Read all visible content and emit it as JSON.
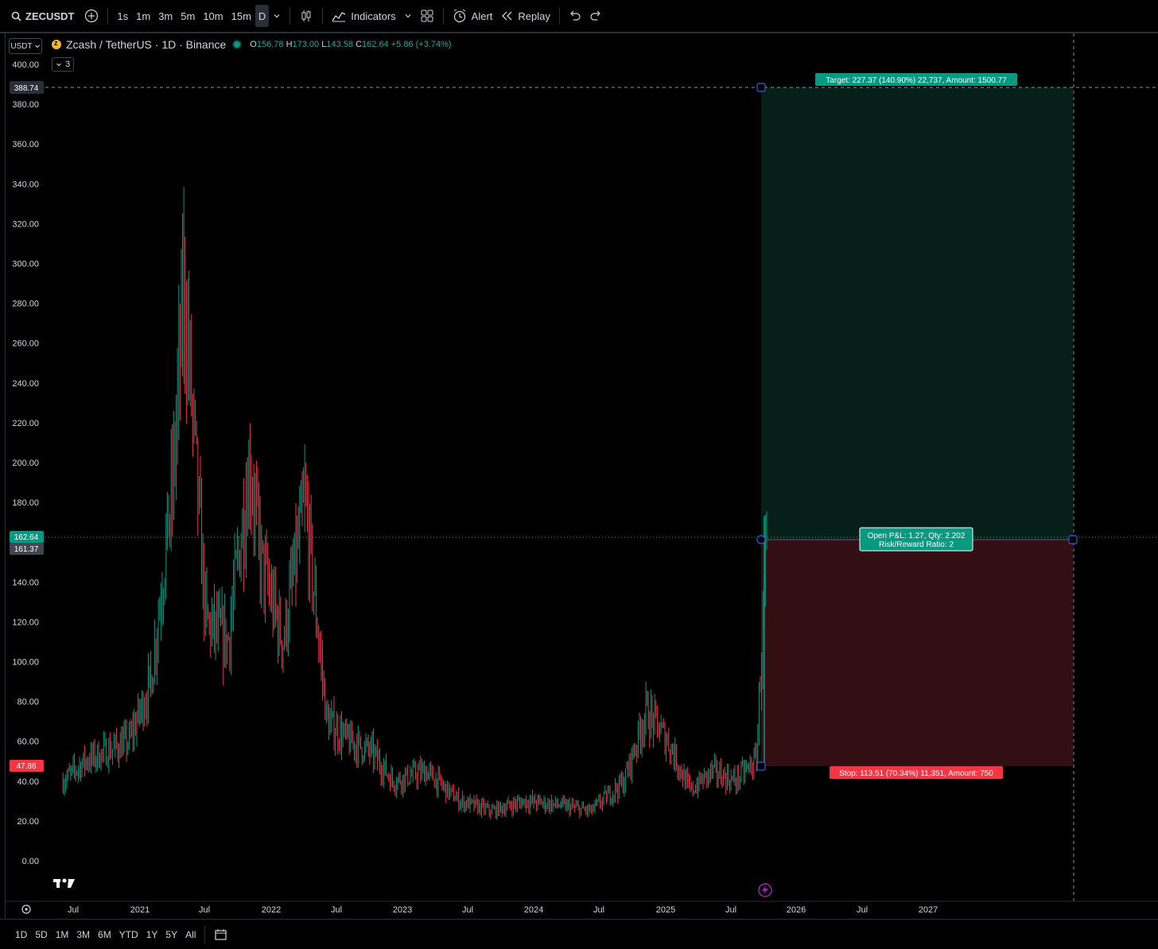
{
  "toolbar": {
    "symbol": "ZECUSDT",
    "intervals": [
      "1s",
      "1m",
      "3m",
      "5m",
      "10m",
      "15m"
    ],
    "active_interval": "D",
    "indicators_label": "Indicators",
    "alert_label": "Alert",
    "replay_label": "Replay"
  },
  "legend": {
    "currency": "USDT",
    "title": "Zcash / TetherUS · 1D · Binance",
    "o_label": "O",
    "o_value": "156.78",
    "h_label": "H",
    "h_value": "173.00",
    "l_label": "L",
    "l_value": "143.58",
    "c_label": "C",
    "c_value": "162.64",
    "change": "+5.86 (+3.74%)",
    "collapse_count": "3"
  },
  "price_axis": {
    "ticks": [
      "400.00",
      "380.00",
      "360.00",
      "340.00",
      "320.00",
      "300.00",
      "280.00",
      "260.00",
      "240.00",
      "220.00",
      "200.00",
      "180.00",
      "140.00",
      "120.00",
      "100.00",
      "80.00",
      "60.00",
      "40.00",
      "20.00",
      "0.00"
    ],
    "crosshair_label": "388.74",
    "last_price_label": "162.64",
    "prev_close_label": "161.37",
    "stop_label": "47.86"
  },
  "time_axis": {
    "labels": [
      "Jul",
      "2021",
      "Jul",
      "2022",
      "Jul",
      "2023",
      "Jul",
      "2024",
      "Jul",
      "2025",
      "Jul",
      "2026",
      "Jul",
      "2027"
    ]
  },
  "position": {
    "target_text": "Target: 227.37 (140.90%) 22,737, Amount: 1500.77",
    "stop_text": "Stop: 113.51 (70.34%) 11,351, Amount: 750",
    "pnl_text": "Open P&L: 1.27, Qty: 2.202",
    "rr_text": "Risk/Reward Ratio: 2",
    "profit_color": "#062019",
    "loss_color": "#330e13"
  },
  "chart_data": {
    "type": "candlestick",
    "symbol": "ZECUSDT",
    "interval": "1D",
    "y_range": [
      0,
      400
    ],
    "approx_series": {
      "x": [
        "2020-06",
        "2020-08",
        "2020-10",
        "2020-12",
        "2021-02",
        "2021-04",
        "2021-05",
        "2021-07",
        "2021-09",
        "2021-11",
        "2021-12",
        "2022-02",
        "2022-04",
        "2022-06",
        "2022-08",
        "2022-10",
        "2022-12",
        "2023-03",
        "2023-06",
        "2023-09",
        "2023-12",
        "2024-03",
        "2024-06",
        "2024-09",
        "2024-11",
        "2025-01",
        "2025-03",
        "2025-05",
        "2025-07",
        "2025-09",
        "2025-10"
      ],
      "close": [
        40,
        50,
        55,
        60,
        90,
        190,
        290,
        120,
        110,
        200,
        150,
        110,
        180,
        70,
        60,
        55,
        40,
        45,
        30,
        25,
        30,
        28,
        25,
        40,
        75,
        60,
        35,
        45,
        40,
        50,
        162.64
      ]
    },
    "last": {
      "open": 156.78,
      "high": 173.0,
      "low": 143.58,
      "close": 162.64
    }
  },
  "bottom": {
    "ranges": [
      "1D",
      "5D",
      "1M",
      "3M",
      "6M",
      "YTD",
      "1Y",
      "5Y",
      "All"
    ]
  }
}
